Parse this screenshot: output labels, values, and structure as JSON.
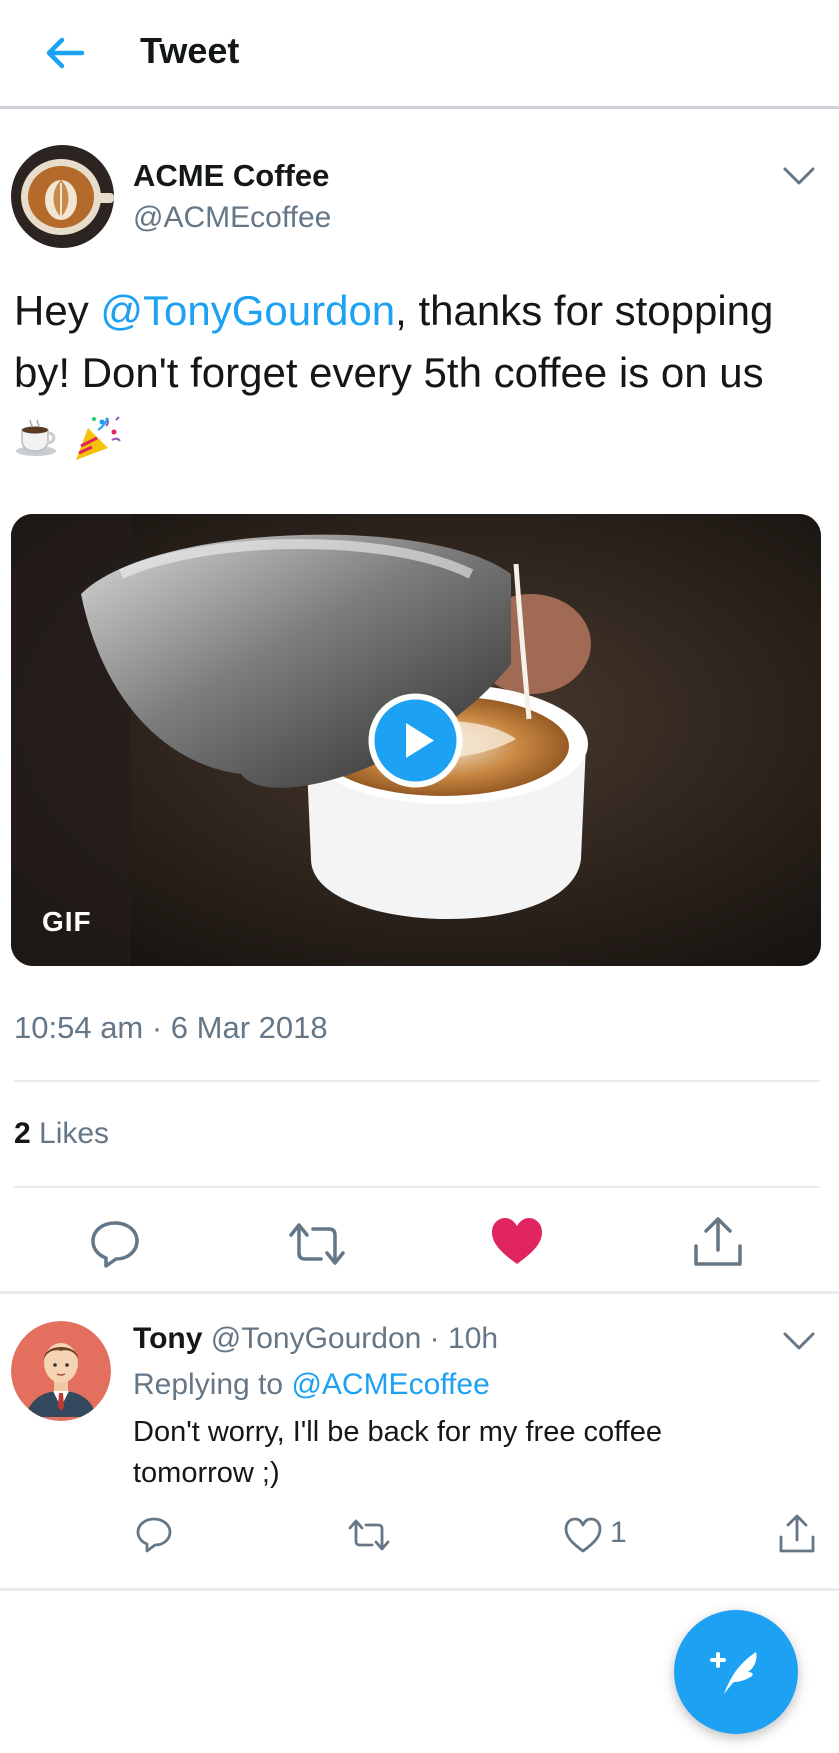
{
  "header": {
    "title": "Tweet",
    "back_icon": "arrow-left-icon"
  },
  "tweet": {
    "author_name": "ACME Coffee",
    "author_handle": "@ACMEcoffee",
    "text_before": "Hey ",
    "mention": "@TonyGourdon",
    "text_after": ", thanks for stopping by! Don't forget every 5th coffee is on us ",
    "emojis": [
      "coffee-cup-icon",
      "party-popper-icon"
    ],
    "media_badge": "GIF",
    "timestamp": "10:54 am · 6 Mar 2018",
    "likes_count": "2",
    "likes_label": " Likes",
    "liked": true
  },
  "reply": {
    "name": "Tony",
    "meta": " @TonyGourdon · 10h",
    "replying_prefix": "Replying to ",
    "replying_handle": "@ACMEcoffee",
    "text": "Don't worry, I'll be back for my free coffee tomorrow ;)",
    "like_count": "1"
  },
  "colors": {
    "accent": "#1da1f2",
    "like": "#e0245e",
    "secondary_text": "#657786",
    "primary_text": "#14171a",
    "divider": "#e6ecf0"
  },
  "fab": {
    "icon": "compose-feather-icon"
  }
}
